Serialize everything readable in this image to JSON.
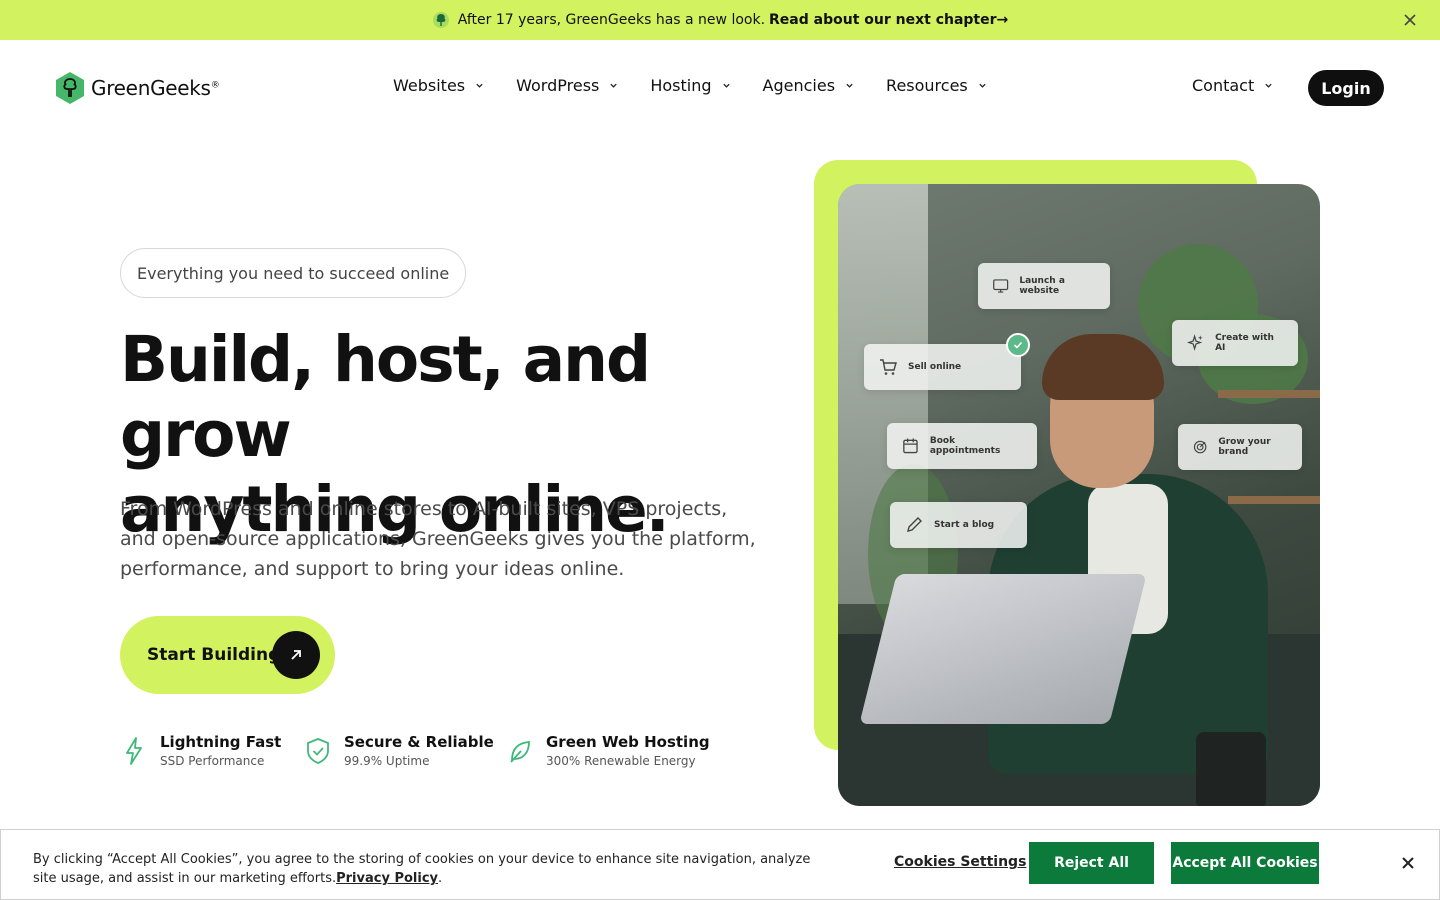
{
  "announcement": {
    "text": "After 17 years, GreenGeeks has a new look.",
    "link": "Read about our next chapter→",
    "icon": "tree-icon",
    "close_icon": "close-icon"
  },
  "brand": {
    "name": "GreenGeeks",
    "reg": "®"
  },
  "nav": {
    "items": [
      {
        "label": "Websites"
      },
      {
        "label": "WordPress"
      },
      {
        "label": "Hosting"
      },
      {
        "label": "Agencies"
      },
      {
        "label": "Resources"
      }
    ],
    "contact": "Contact",
    "login": "Login"
  },
  "hero": {
    "eyebrow": "Everything you need to succeed online",
    "headline_line1": "Build, host, and grow",
    "headline_line2": "anything online.",
    "subtext": "From WordPress and online stores to AI-built sites, VPS projects, and open-source applications, GreenGeeks gives you the platform, performance, and support to bring your ideas online.",
    "cta": "Start Building"
  },
  "features": [
    {
      "title": "Lightning Fast",
      "subtitle": "SSD Performance",
      "icon": "lightning-icon"
    },
    {
      "title": "Secure & Reliable",
      "subtitle": "99.9% Uptime",
      "icon": "shield-check-icon"
    },
    {
      "title": "Green Web Hosting",
      "subtitle": "300% Renewable Energy",
      "icon": "leaf-icon"
    }
  ],
  "hero_chips": {
    "launch": "Launch a website",
    "create_ai": "Create with AI",
    "sell": "Sell online",
    "book": "Book appointments",
    "grow": "Grow your brand",
    "blog": "Start a blog"
  },
  "cookie": {
    "message": "By clicking “Accept All Cookies”, you agree to the storing of cookies on your device to enhance site navigation, analyze site usage, and assist in our marketing efforts.",
    "policy": "Privacy Policy",
    "period": ".",
    "settings": "Cookies Settings",
    "reject": "Reject All",
    "accept": "Accept All Cookies"
  },
  "colors": {
    "accent_lime": "#d3f260",
    "cookie_green": "#0b7a3b",
    "dark": "#111111"
  }
}
